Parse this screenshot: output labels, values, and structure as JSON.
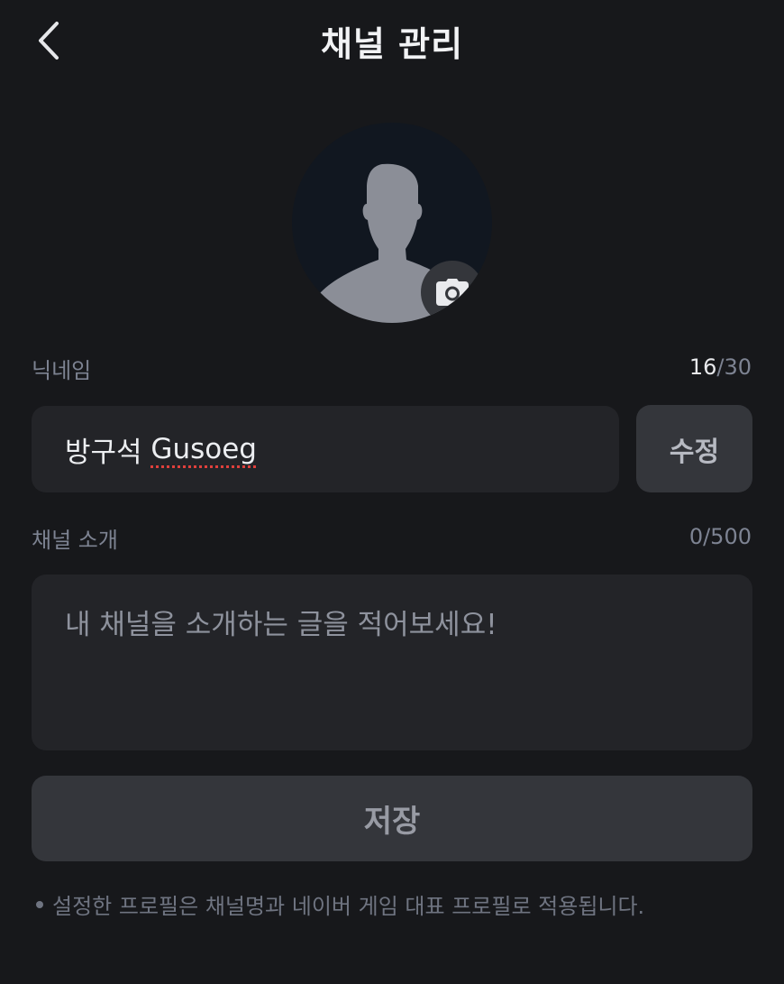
{
  "header": {
    "title": "채널 관리",
    "back_icon": "chevron-left-icon"
  },
  "avatar": {
    "placeholder_icon": "person-silhouette-icon",
    "camera_icon": "camera-icon"
  },
  "nickname": {
    "label": "닉네임",
    "count_current": "16",
    "count_max": "/30",
    "value_prefix": "방구석 ",
    "value_word": "Gusoeg",
    "edit_label": "수정"
  },
  "intro": {
    "label": "채널 소개",
    "counter": "0/500",
    "placeholder": "내 채널을 소개하는 글을 적어보세요!"
  },
  "save_label": "저장",
  "note": "설정한 프로필은 채널명과 네이버 게임 대표 프로필로 적용됩니다.",
  "colors": {
    "background": "#17181b",
    "field": "#232428",
    "button": "#34363b",
    "muted_text": "#7d8392"
  }
}
